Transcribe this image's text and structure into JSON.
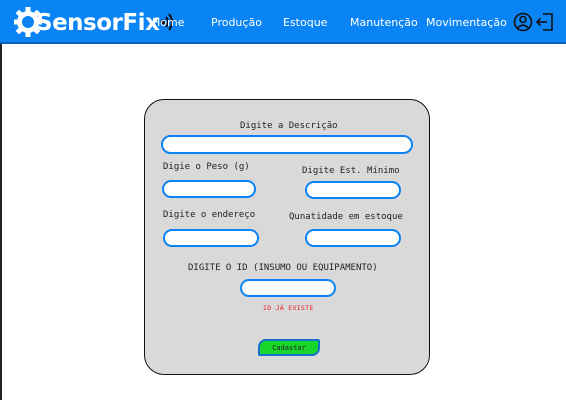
{
  "header": {
    "logo_text": "SensorFix",
    "nav": [
      "Home",
      "Produção",
      "Estoque",
      "Manutenção",
      "Movimentação"
    ]
  },
  "form": {
    "description_label": "Digite a Descrição",
    "weight_label": "Digie o Peso (g)",
    "min_stock_label": "Digite Est. Mínimo",
    "address_label": "Digite o endereço",
    "quantity_label": "Qunatidade em estoque",
    "id_label": "DIGITE O ID (INSUMO OU EQUIPAMENTO)",
    "id_error": "ID JÁ EXISTE",
    "submit_label": "Cadastar",
    "description_value": "",
    "weight_value": "",
    "min_stock_value": "",
    "address_value": "",
    "quantity_value": "",
    "id_value": ""
  },
  "colors": {
    "header_bg": "#0a84f5",
    "card_bg": "#d9d9d9",
    "input_border": "#0a84f5",
    "button_bg": "#19d62a",
    "error": "#e8202a"
  },
  "icons": [
    "gear-icon",
    "sound-waves-icon",
    "user-icon",
    "logout-icon"
  ]
}
